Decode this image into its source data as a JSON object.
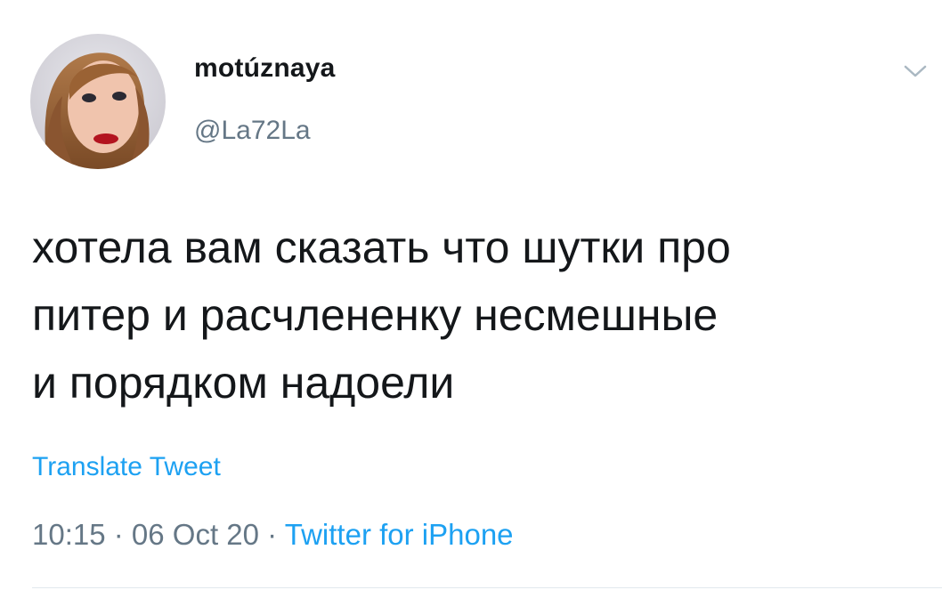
{
  "tweet": {
    "author_name": "motúznaya",
    "author_handle": "@La72La",
    "text_lines": [
      "хотела вам сказать что шутки про",
      "питер и расчлененку несмешные",
      "и порядком надоели"
    ],
    "translate_label": "Translate Tweet",
    "time": "10:15",
    "date": "06 Oct 20",
    "separator": " · ",
    "source": "Twitter for iPhone"
  },
  "icons": {
    "menu": "chevron-down-icon",
    "avatar": "profile-photo"
  },
  "colors": {
    "text": "#14171a",
    "secondary": "#657786",
    "link": "#1da1f2"
  }
}
